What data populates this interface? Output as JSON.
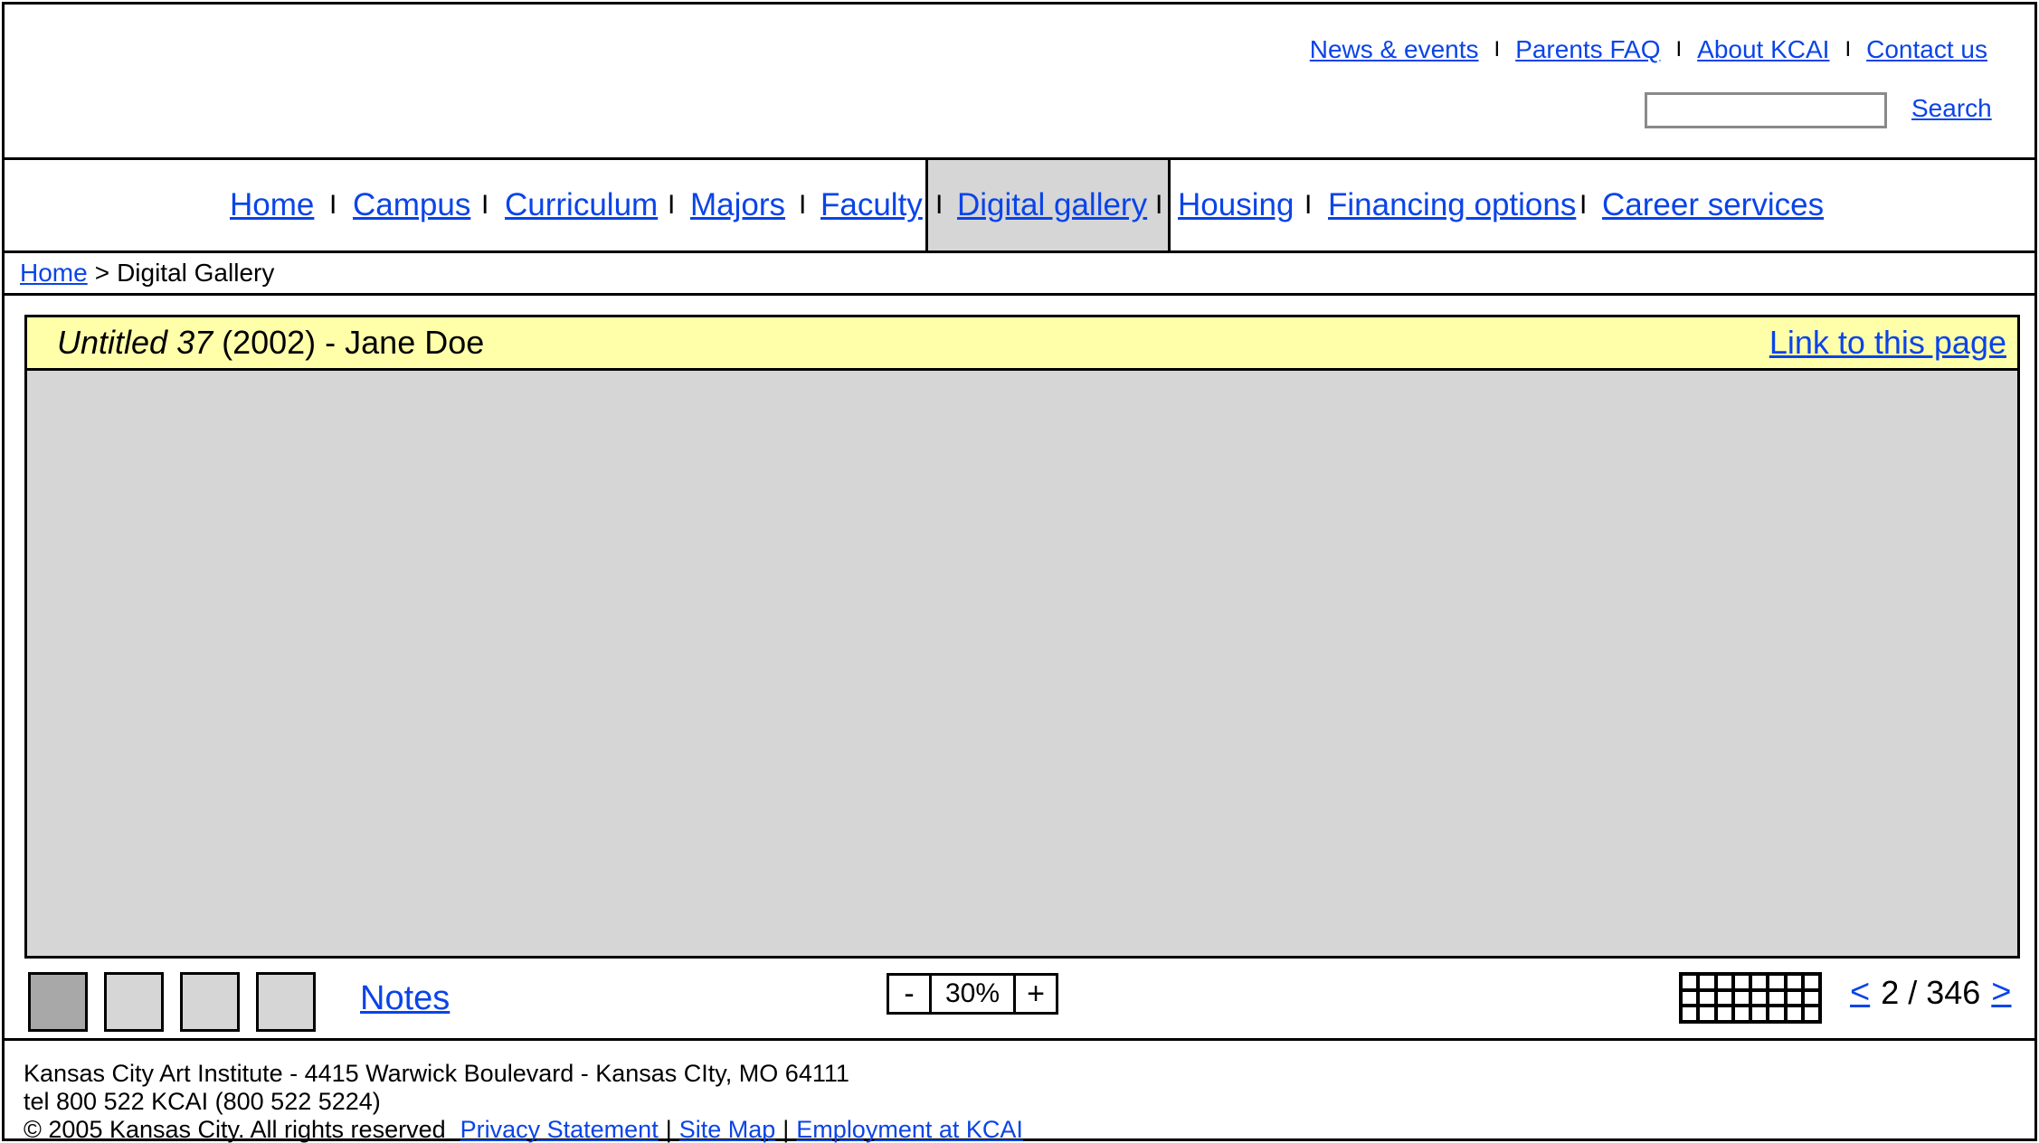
{
  "utility_nav": {
    "links": [
      "News & events",
      "Parents FAQ",
      "About KCAI",
      "Contact us"
    ],
    "separator": "I"
  },
  "search": {
    "value": "",
    "placeholder": "",
    "button_label": "Search"
  },
  "main_nav": {
    "items": [
      "Home",
      "Campus",
      "Curriculum",
      "Majors",
      "Faculty",
      "Digital gallery",
      "Housing",
      "Financing options",
      "Career services"
    ],
    "active": "Digital gallery",
    "separator": "I"
  },
  "breadcrumb": {
    "home": "Home",
    "separator": ">",
    "current": "Digital Gallery"
  },
  "artwork": {
    "title": "Untitled 37",
    "year_artist": "(2002) - Jane Doe",
    "link_label": "Link to this page"
  },
  "viewer": {
    "thumbnails_count": 4,
    "active_thumbnail": 1,
    "notes_label": "Notes",
    "zoom_minus": "-",
    "zoom_value": "30%",
    "zoom_plus": "+",
    "grid_icon": "grid-view-icon",
    "pager_prev": "<",
    "pager_count": "2 / 346",
    "pager_next": ">"
  },
  "footer": {
    "address": "Kansas City Art Institute - 4415 Warwick Boulevard - Kansas CIty, MO 64111",
    "tel": "tel 800 522 KCAI (800 522 5224)",
    "copyright": "© 2005 Kansas City. All rights reserved",
    "links": [
      "Privacy Statement",
      "Site Map",
      "Employment at KCAI"
    ],
    "link_separator": "|"
  },
  "colors": {
    "link": "#0a44e8",
    "title_bar": "#ffffaa",
    "placeholder_gray": "#d6d6d6",
    "active_thumb": "#a8a8a8"
  }
}
